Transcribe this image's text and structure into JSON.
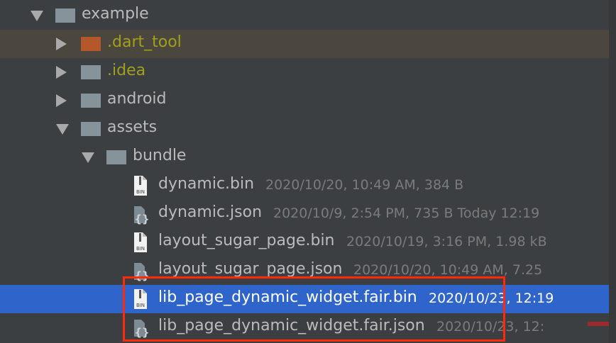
{
  "tree": [
    {
      "name": "example",
      "type": "folder",
      "expanded": true,
      "depth": 0
    },
    {
      "name": ".dart_tool",
      "type": "folder",
      "expanded": false,
      "depth": 1,
      "excluded": true,
      "highlighted": true,
      "folder_color": "#b4582b"
    },
    {
      "name": ".idea",
      "type": "folder",
      "expanded": false,
      "depth": 1,
      "excluded": true
    },
    {
      "name": "android",
      "type": "folder",
      "expanded": false,
      "depth": 1
    },
    {
      "name": "assets",
      "type": "folder",
      "expanded": true,
      "depth": 1
    },
    {
      "name": "bundle",
      "type": "folder",
      "expanded": true,
      "depth": 2
    },
    {
      "name": "dynamic.bin",
      "type": "bin",
      "depth": 3,
      "meta": "2020/10/20, 10:49 AM, 384 B"
    },
    {
      "name": "dynamic.json",
      "type": "json",
      "depth": 3,
      "meta": "2020/10/9, 2:54 PM, 735 B Today 12:19"
    },
    {
      "name": "layout_sugar_page.bin",
      "type": "bin",
      "depth": 3,
      "meta": "2020/10/19, 3:16 PM, 1.98 kB"
    },
    {
      "name": "layout_sugar_page.json",
      "type": "json",
      "depth": 3,
      "meta": "2020/10/20, 10:49 AM, 7.25"
    },
    {
      "name": "lib_page_dynamic_widget.fair.bin",
      "type": "bin",
      "depth": 3,
      "selected": true,
      "meta": "2020/10/23, 12:19"
    },
    {
      "name": "lib_page_dynamic_widget.fair.json",
      "type": "json",
      "depth": 3,
      "meta": "2020/10/23, 12:"
    }
  ],
  "bin_icon_label": "BIN",
  "colors": {
    "background": "#3c3f41",
    "selection": "#2f65ca",
    "highlight": "#4b473e",
    "annotation": "#ff2a0c",
    "excluded_text": "#a0a01b"
  }
}
